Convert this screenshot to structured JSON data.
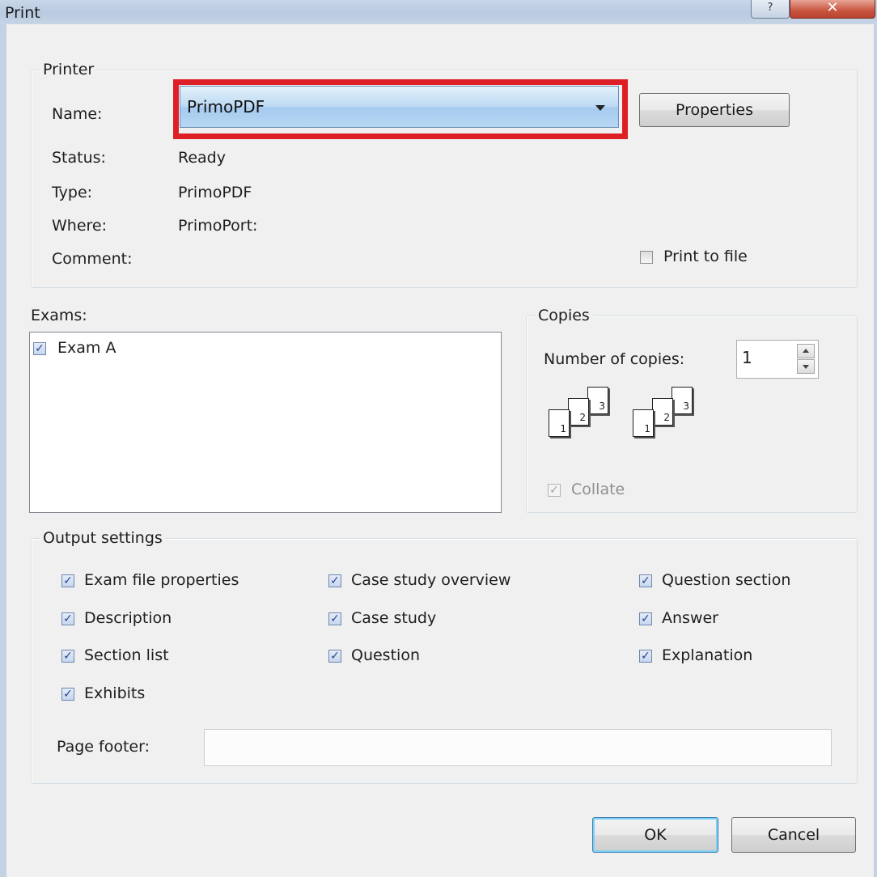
{
  "window": {
    "title": "Print",
    "help_glyph": "?",
    "close_glyph": "✕"
  },
  "printer": {
    "legend": "Printer",
    "name_label": "Name:",
    "name_value": "PrimoPDF",
    "properties_button": "Properties",
    "status_label": "Status:",
    "status_value": "Ready",
    "type_label": "Type:",
    "type_value": "PrimoPDF",
    "where_label": "Where:",
    "where_value": "PrimoPort:",
    "comment_label": "Comment:",
    "print_to_file_label": "Print to file",
    "print_to_file_checked": false
  },
  "exams": {
    "label": "Exams:",
    "items": [
      {
        "label": "Exam A",
        "checked": true
      }
    ]
  },
  "copies": {
    "legend": "Copies",
    "number_label": "Number of copies:",
    "number_value": "1",
    "collate_label": "Collate",
    "collate_checked": true,
    "collate_disabled": true
  },
  "output": {
    "legend": "Output settings",
    "options": [
      {
        "label": "Exam file properties",
        "checked": true
      },
      {
        "label": "Description",
        "checked": true
      },
      {
        "label": "Section list",
        "checked": true
      },
      {
        "label": "Exhibits",
        "checked": true
      },
      {
        "label": "Case study overview",
        "checked": true
      },
      {
        "label": "Case study",
        "checked": true
      },
      {
        "label": "Question",
        "checked": true
      },
      {
        "label": "Question section",
        "checked": true
      },
      {
        "label": "Answer",
        "checked": true
      },
      {
        "label": "Explanation",
        "checked": true
      }
    ],
    "page_footer_label": "Page footer:",
    "page_footer_value": ""
  },
  "buttons": {
    "ok": "OK",
    "cancel": "Cancel"
  },
  "colors": {
    "highlight": "#df1f26",
    "combo_selected": "#bcd9f3",
    "dialog_bg": "#f0f0f0"
  }
}
